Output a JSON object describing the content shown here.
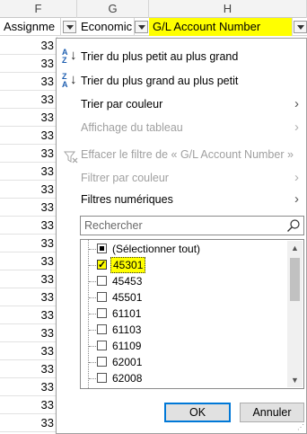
{
  "columns": {
    "F": "F",
    "G": "G",
    "H": "H"
  },
  "headers": {
    "F": "Assignme",
    "G": "Economic",
    "H": "G/L Account Number"
  },
  "cell_value": "33",
  "menu": {
    "sort_asc": "Trier du plus petit au plus grand",
    "sort_desc": "Trier du plus grand au plus petit",
    "sort_by_color": "Trier par couleur",
    "sheet_view": "Affichage du tableau",
    "clear_filter": "Effacer le filtre de « G/L Account Number »",
    "filter_by_color": "Filtrer par couleur",
    "number_filters": "Filtres numériques",
    "search_placeholder": "Rechercher",
    "select_all": "(Sélectionner tout)",
    "values": [
      "45301",
      "45453",
      "45501",
      "61101",
      "61103",
      "61109",
      "62001",
      "62008"
    ],
    "ok": "OK",
    "cancel": "Annuler"
  },
  "icons": {
    "sort_asc": "sort-ascending-icon",
    "sort_desc": "sort-descending-icon",
    "clear_filter": "clear-filter-icon",
    "search": "search-icon",
    "submenu": "chevron-right-icon"
  },
  "colors": {
    "header_highlight": "#ffff00",
    "ok_border": "#0078d7"
  }
}
